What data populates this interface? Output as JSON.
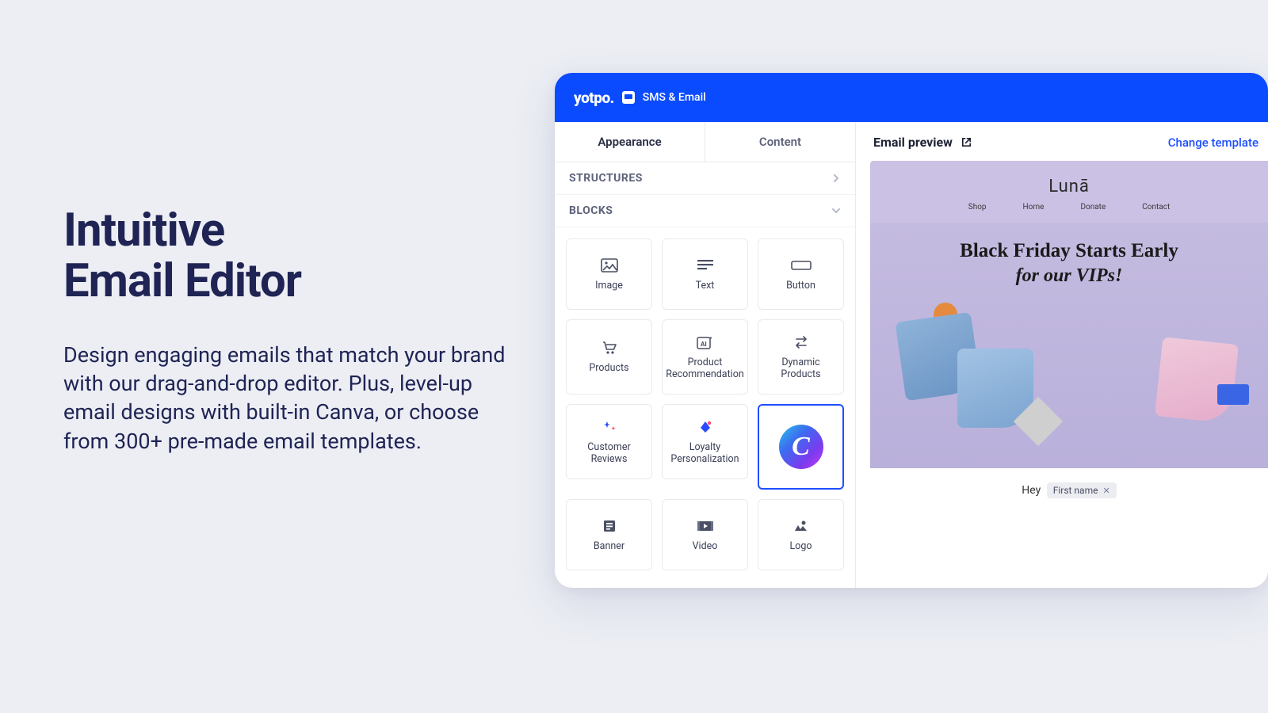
{
  "marketing": {
    "title_line1": "Intuitive",
    "title_line2": "Email Editor",
    "body": "Design engaging emails that match your brand with our drag-and-drop editor. Plus, level-up email designs with built-in Canva, or choose from 300+ pre-made email templates."
  },
  "header": {
    "brand": "yotpo.",
    "product": "SMS & Email"
  },
  "panel": {
    "tabs": {
      "appearance": "Appearance",
      "content": "Content"
    },
    "sections": {
      "structures": "STRUCTURES",
      "blocks": "BLOCKS"
    },
    "blocks": {
      "image": "Image",
      "text": "Text",
      "button": "Button",
      "products": "Products",
      "product_reco": "Product Recommendation",
      "dynamic_products": "Dynamic Products",
      "customer_reviews": "Customer Reviews",
      "loyalty": "Loyalty Personalization",
      "banner": "Banner",
      "video": "Video",
      "logo": "Logo"
    }
  },
  "preview": {
    "title": "Email preview",
    "change_template": "Change template",
    "email": {
      "brand": "Lunā",
      "nav": {
        "shop": "Shop",
        "home": "Home",
        "donate": "Donate",
        "contact": "Contact"
      },
      "headline1": "Black Friday Starts Early",
      "headline2": "for our VIPs!",
      "greeting": "Hey",
      "token": "First name"
    }
  }
}
